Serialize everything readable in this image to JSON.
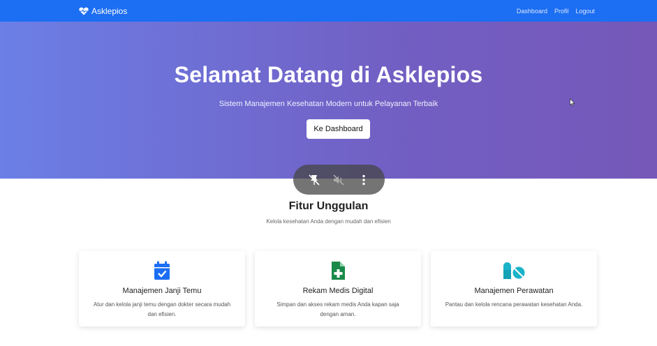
{
  "navbar": {
    "brand": "Asklepios",
    "links": [
      "Dashboard",
      "Profil",
      "Logout"
    ],
    "color": "#1c6ef2"
  },
  "hero": {
    "title": "Selamat Datang di Asklepios",
    "subtitle": "Sistem Manajemen Kesehatan Modern untuk Pelayanan Terbaik",
    "cta": "Ke Dashboard"
  },
  "features": {
    "title": "Fitur Unggulan",
    "subtitle": "Kelola kesehatan Anda dengan mudah dan efisien",
    "cards": [
      {
        "icon": "calendar-check-icon",
        "color": "#1c6ef2",
        "title": "Manajemen Janji Temu",
        "desc": "Atur dan kelola janji temu dengan dokter secara mudah dan efisien."
      },
      {
        "icon": "file-medical-icon",
        "color": "#1a8a4a",
        "title": "Rekam Medis Digital",
        "desc": "Simpan dan akses rekam medis Anda kapan saja dengan aman."
      },
      {
        "icon": "pills-icon",
        "color": "#1ab3c9",
        "title": "Manajemen Perawatan",
        "desc": "Pantau dan kelola rencana perawatan kesehatan Anda."
      }
    ]
  },
  "media_bar": {
    "icons": [
      "pin-off-icon",
      "sound-off-icon",
      "more-vertical-icon"
    ]
  }
}
